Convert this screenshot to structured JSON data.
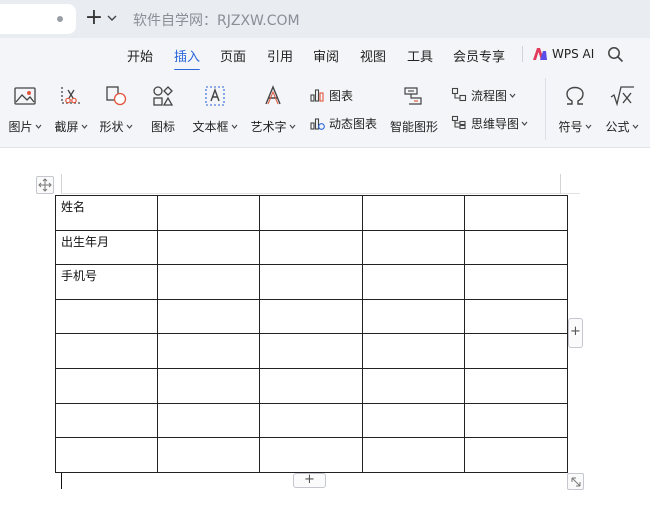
{
  "titlebar": {
    "site_label": "软件自学网：RJZXW.COM",
    "new_tab_glyph": "+"
  },
  "menu": {
    "tabs": [
      {
        "label": "开始"
      },
      {
        "label": "插入",
        "active": true
      },
      {
        "label": "页面"
      },
      {
        "label": "引用"
      },
      {
        "label": "审阅"
      },
      {
        "label": "视图"
      },
      {
        "label": "工具"
      },
      {
        "label": "会员专享"
      }
    ],
    "ai_label": "WPS AI"
  },
  "ribbon": {
    "picture": "图片",
    "screenshot": "截屏",
    "shape": "形状",
    "icon": "图标",
    "textbox": "文本框",
    "wordart": "艺术字",
    "chart": "图表",
    "dynamic_chart": "动态图表",
    "smart_graphic": "智能图形",
    "flowchart": "流程图",
    "mindmap": "思维导图",
    "symbol": "符号",
    "formula": "公式"
  },
  "table": {
    "rows": [
      [
        "姓名",
        "",
        "",
        "",
        ""
      ],
      [
        "出生年月",
        "",
        "",
        "",
        ""
      ],
      [
        "手机号",
        "",
        "",
        "",
        ""
      ],
      [
        "",
        "",
        "",
        "",
        ""
      ],
      [
        "",
        "",
        "",
        "",
        ""
      ],
      [
        "",
        "",
        "",
        "",
        ""
      ],
      [
        "",
        "",
        "",
        "",
        ""
      ],
      [
        "",
        "",
        "",
        "",
        ""
      ]
    ]
  },
  "table_controls": {
    "add_glyph": "+"
  },
  "colors": {
    "accent": "#2b66d9",
    "ribbon_bg": "#f3f5f8",
    "titlebar_bg": "#e9ecf1"
  }
}
